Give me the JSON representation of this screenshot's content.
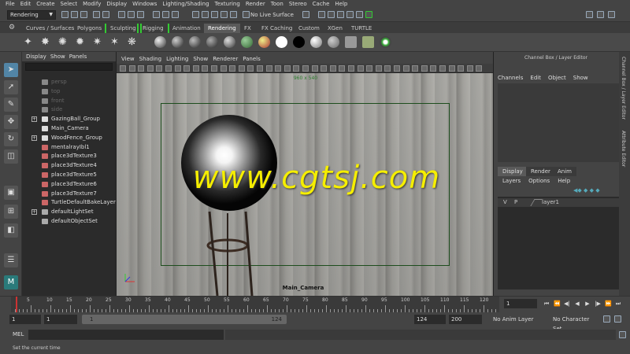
{
  "menubar": [
    "File",
    "Edit",
    "Create",
    "Select",
    "Modify",
    "Display",
    "Windows",
    "Lighting/Shading",
    "Texturing",
    "Render",
    "Toon",
    "Stereo",
    "Cache",
    "Help"
  ],
  "statusline": {
    "mode": "Rendering",
    "live_surface": "No Live Surface"
  },
  "shelf_tabs": [
    "Curves / Surfaces",
    "Polygons",
    "Sculpting",
    "Rigging",
    "Animation",
    "Rendering",
    "FX",
    "FX Caching",
    "Custom",
    "XGen",
    "TURTLE"
  ],
  "shelf_active_tab": "Rendering",
  "outliner": {
    "menu": [
      "Display",
      "Show",
      "Panels"
    ],
    "items": [
      {
        "label": "persp",
        "dim": true,
        "expand": false
      },
      {
        "label": "top",
        "dim": true,
        "expand": false
      },
      {
        "label": "front",
        "dim": true,
        "expand": false
      },
      {
        "label": "side",
        "dim": true,
        "expand": false
      },
      {
        "label": "GazingBall_Group",
        "dim": false,
        "expand": true
      },
      {
        "label": "Main_Camera",
        "dim": false,
        "expand": false
      },
      {
        "label": "WoodFence_Group",
        "dim": false,
        "expand": true
      },
      {
        "label": "mentalrayIbl1",
        "dim": false,
        "expand": false
      },
      {
        "label": "place3dTexture3",
        "dim": false,
        "expand": false
      },
      {
        "label": "place3dTexture4",
        "dim": false,
        "expand": false
      },
      {
        "label": "place3dTexture5",
        "dim": false,
        "expand": false
      },
      {
        "label": "place3dTexture6",
        "dim": false,
        "expand": false
      },
      {
        "label": "place3dTexture7",
        "dim": false,
        "expand": false
      },
      {
        "label": "TurtleDefaultBakeLayer",
        "dim": false,
        "expand": false
      },
      {
        "label": "defaultLightSet",
        "dim": false,
        "expand": true
      },
      {
        "label": "defaultObjectSet",
        "dim": false,
        "expand": false
      }
    ]
  },
  "viewport": {
    "menu": [
      "View",
      "Shading",
      "Lighting",
      "Show",
      "Renderer",
      "Panels"
    ],
    "resolution": "960 x 540",
    "camera_label": "Main_Camera"
  },
  "watermark": "www.cgtsj.com",
  "channel_box": {
    "title": "Channel Box / Layer Editor",
    "menu": [
      "Channels",
      "Edit",
      "Object",
      "Show"
    ],
    "layer_tabs": [
      "Display",
      "Render",
      "Anim"
    ],
    "layer_menu": [
      "Layers",
      "Options",
      "Help"
    ],
    "layer": {
      "v": "V",
      "p": "P",
      "name": "layer1"
    },
    "side_tabs": [
      "Channel Box / Layer Editor",
      "Attribute Editor"
    ]
  },
  "timeslider": {
    "ticks": [
      "5",
      "10",
      "15",
      "20",
      "25",
      "30",
      "35",
      "40",
      "45",
      "50",
      "55",
      "60",
      "65",
      "70",
      "75",
      "80",
      "85",
      "90",
      "95",
      "100",
      "105",
      "110",
      "115",
      "120"
    ],
    "current_frame": "1"
  },
  "range": {
    "start": "1",
    "anim_start": "1",
    "range_start": "1",
    "range_end": "124",
    "end_field": "124",
    "anim_end": "200",
    "anim_layer": "No Anim Layer",
    "character_set": "No Character Set"
  },
  "cmdline": {
    "label": "MEL"
  },
  "helpline": "Set the current time"
}
